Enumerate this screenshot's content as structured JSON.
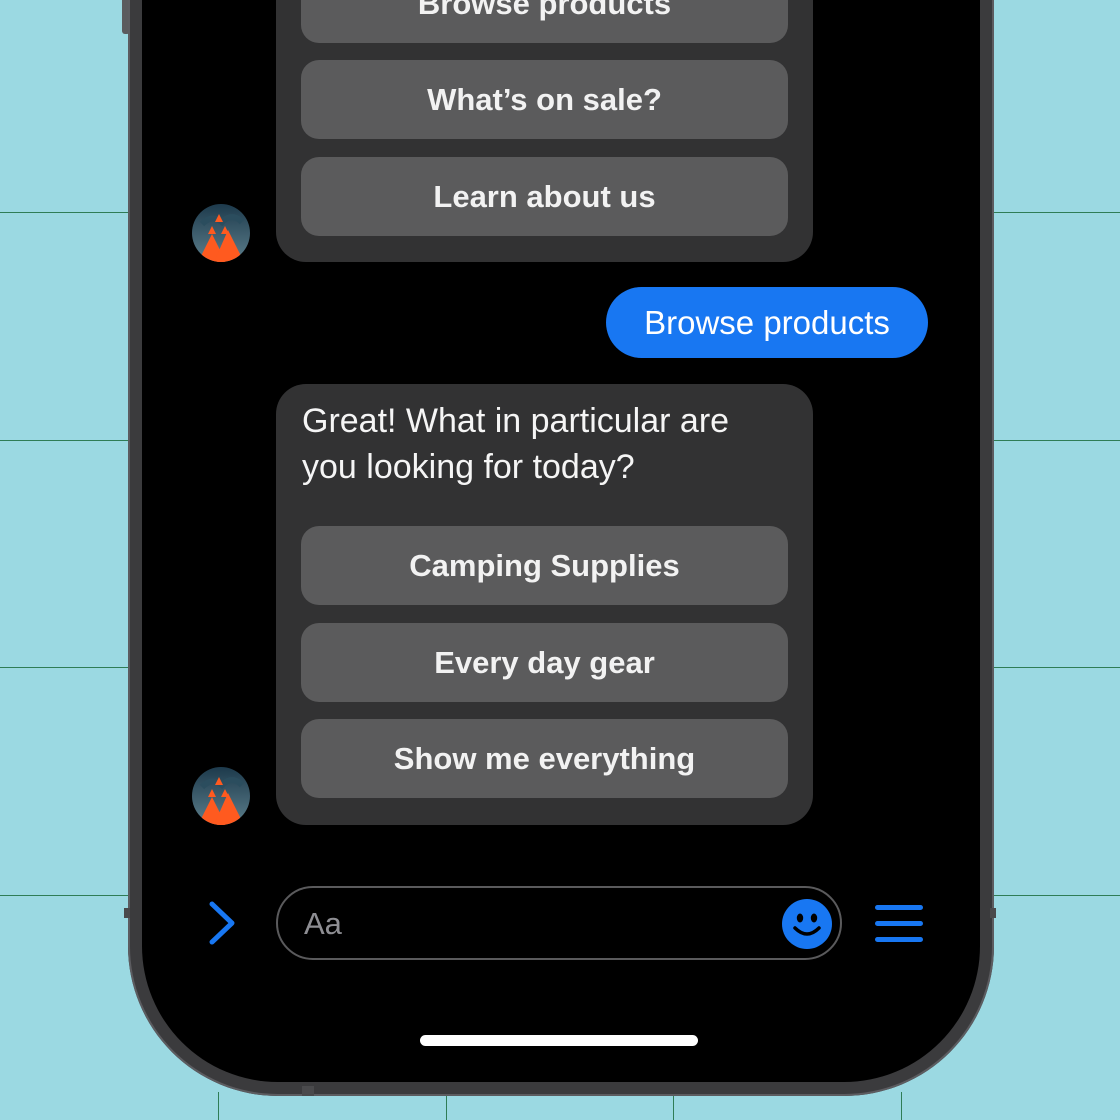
{
  "conversation": {
    "first_card": {
      "buttons": [
        "Browse products",
        "What’s on sale?",
        "Learn about us"
      ]
    },
    "user_message": "Browse products",
    "second_card": {
      "text": "Great! What in particular are you looking for today?",
      "buttons": [
        "Camping Supplies",
        "Every day gear",
        "Show me everything"
      ]
    }
  },
  "composer": {
    "placeholder": "Aa"
  },
  "icons": {
    "expand": "chevron-right-icon",
    "emoji": "smiley-icon",
    "menu": "hamburger-menu-icon"
  },
  "colors": {
    "accent": "#1877f2",
    "card": "#323233",
    "button": "#5b5b5c",
    "background": "#9bd9e2"
  }
}
